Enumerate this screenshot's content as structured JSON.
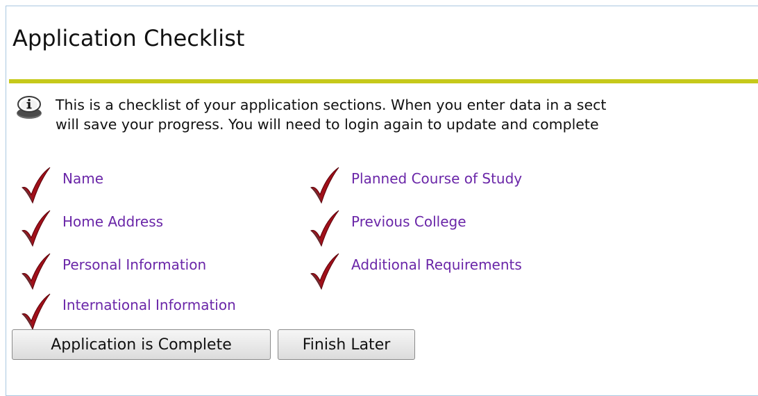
{
  "page": {
    "title": "Application Checklist",
    "info_line_1": "This is a checklist of your application sections. When you enter data in a sect",
    "info_line_2": "will save your progress. You will need to login again to update and complete "
  },
  "checklist": {
    "left": [
      {
        "label": "Name",
        "checked": true
      },
      {
        "label": "Home Address",
        "checked": true
      },
      {
        "label": "Personal Information",
        "checked": true
      },
      {
        "label": "International Information",
        "checked": true
      }
    ],
    "right": [
      {
        "label": "Planned Course of Study",
        "checked": true
      },
      {
        "label": "Previous College",
        "checked": true
      },
      {
        "label": "Additional Requirements",
        "checked": true
      }
    ]
  },
  "buttons": {
    "complete_label": "Application is Complete",
    "finish_later_label": "Finish Later"
  },
  "colors": {
    "accent_rule": "#c6c91a",
    "link": "#6a26a8",
    "check": "#a0101a"
  },
  "icons": {
    "info": "info-icon",
    "check": "checkmark-icon"
  }
}
